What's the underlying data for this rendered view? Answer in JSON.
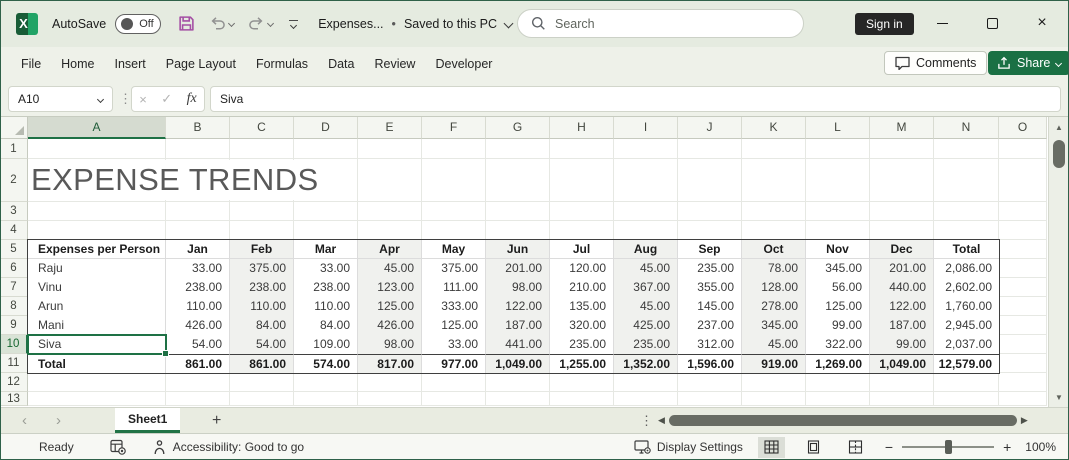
{
  "colors": {
    "accent_green": "#217346",
    "share_green": "#1a7044",
    "save_purple": "#a44fa4",
    "selection_green": "#1e7145",
    "band_gray": "#f0f1ee",
    "titlebar_bg": "#e5ebe0"
  },
  "titlebar": {
    "app_icon_letter": "X",
    "autosave_label": "AutoSave",
    "autosave_state": "Off",
    "doc_name": "Expenses...",
    "bullet": "•",
    "saved_status": "Saved to this PC",
    "search_placeholder": "Search",
    "sign_in_label": "Sign in"
  },
  "ribbon": {
    "tabs": [
      "File",
      "Home",
      "Insert",
      "Page Layout",
      "Formulas",
      "Data",
      "Review",
      "Developer"
    ],
    "comments_label": "Comments",
    "share_label": "Share"
  },
  "formula_bar": {
    "name_box_value": "A10",
    "formula_value": "Siva"
  },
  "icons": {
    "dots_vertical": "⋮",
    "cancel": "×",
    "confirm": "✓",
    "fx": "fx",
    "vscroll_up": "▲",
    "vscroll_down": "▼",
    "hscroll_left": "◀",
    "hscroll_right": "▶",
    "sheet_prev": "‹",
    "sheet_next": "›",
    "add_sheet": "+",
    "zoom_minus": "−",
    "zoom_plus": "+",
    "close": "×"
  },
  "grid": {
    "column_letters": [
      "A",
      "B",
      "C",
      "D",
      "E",
      "F",
      "G",
      "H",
      "I",
      "J",
      "K",
      "L",
      "M",
      "N",
      "O"
    ],
    "row_numbers": [
      "1",
      "2",
      "3",
      "4",
      "5",
      "6",
      "7",
      "8",
      "9",
      "10",
      "11",
      "12",
      "13"
    ],
    "selected_cell": "A10",
    "selected_column": "A",
    "selected_row": "10",
    "title_text": "EXPENSE TRENDS"
  },
  "table": {
    "header": [
      "Expenses per Person",
      "Jan",
      "Feb",
      "Mar",
      "Apr",
      "May",
      "Jun",
      "Jul",
      "Aug",
      "Sep",
      "Oct",
      "Nov",
      "Dec",
      "Total"
    ],
    "rows": [
      {
        "name": "Raju",
        "values": [
          "33.00",
          "375.00",
          "33.00",
          "45.00",
          "375.00",
          "201.00",
          "120.00",
          "45.00",
          "235.00",
          "78.00",
          "345.00",
          "201.00",
          "2,086.00"
        ]
      },
      {
        "name": "Vinu",
        "values": [
          "238.00",
          "238.00",
          "238.00",
          "123.00",
          "111.00",
          "98.00",
          "210.00",
          "367.00",
          "355.00",
          "128.00",
          "56.00",
          "440.00",
          "2,602.00"
        ]
      },
      {
        "name": "Arun",
        "values": [
          "110.00",
          "110.00",
          "110.00",
          "125.00",
          "333.00",
          "122.00",
          "135.00",
          "45.00",
          "145.00",
          "278.00",
          "125.00",
          "122.00",
          "1,760.00"
        ]
      },
      {
        "name": "Mani",
        "values": [
          "426.00",
          "84.00",
          "84.00",
          "426.00",
          "125.00",
          "187.00",
          "320.00",
          "425.00",
          "237.00",
          "345.00",
          "99.00",
          "187.00",
          "2,945.00"
        ]
      },
      {
        "name": "Siva",
        "values": [
          "54.00",
          "54.00",
          "109.00",
          "98.00",
          "33.00",
          "441.00",
          "235.00",
          "235.00",
          "312.00",
          "45.00",
          "322.00",
          "99.00",
          "2,037.00"
        ]
      }
    ],
    "total": {
      "name": "Total",
      "values": [
        "861.00",
        "861.00",
        "574.00",
        "817.00",
        "977.00",
        "1,049.00",
        "1,255.00",
        "1,352.00",
        "1,596.00",
        "919.00",
        "1,269.00",
        "1,049.00",
        "12,579.00"
      ]
    }
  },
  "sheet_bar": {
    "active_tab": "Sheet1"
  },
  "status_bar": {
    "ready_label": "Ready",
    "accessibility_label": "Accessibility: Good to go",
    "display_settings_label": "Display Settings",
    "zoom_level": "100%"
  }
}
